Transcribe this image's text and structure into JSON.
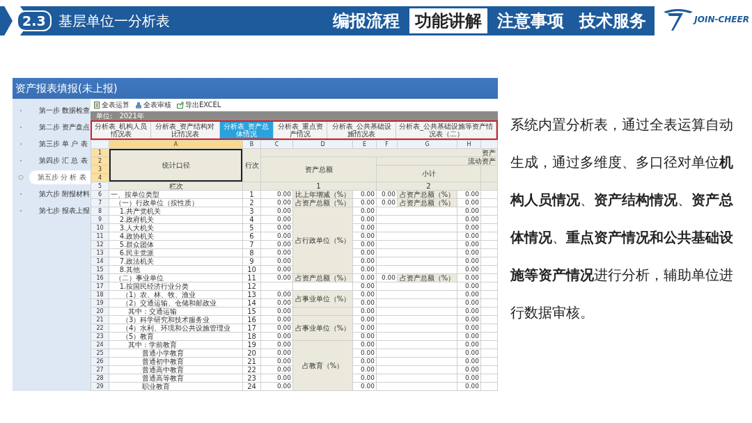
{
  "header": {
    "section_number": "2.3",
    "title": "基层单位一分析表",
    "logo_text": "JOIN-CHEER",
    "nav": [
      {
        "label": "编报流程",
        "selected": false
      },
      {
        "label": "功能讲解",
        "selected": true
      },
      {
        "label": "注意事项",
        "selected": false
      },
      {
        "label": "技术服务",
        "selected": false
      }
    ]
  },
  "app": {
    "title": "资产报表填报(未上报)",
    "steps": [
      {
        "label": "第一步 数据检查",
        "selected": false
      },
      {
        "label": "第二步 资产盘点",
        "selected": false
      },
      {
        "label": "第三步 单 户 表",
        "selected": false
      },
      {
        "label": "第四步 汇 总 表",
        "selected": false
      },
      {
        "label": "第五步 分 析 表",
        "selected": true
      },
      {
        "label": "第六步 附报材料",
        "selected": false
      },
      {
        "label": "第七步 报表上报",
        "selected": false
      }
    ],
    "toolbar": [
      {
        "label": "全表运算",
        "kind": "calc"
      },
      {
        "label": "全表审核",
        "kind": "audit"
      },
      {
        "label": "导出EXCEL",
        "kind": "export"
      }
    ],
    "info": {
      "unit_label": "单位:",
      "year": "2021年"
    },
    "sheet_tabs": [
      {
        "label": "分析表_机构人员情况表",
        "selected": false
      },
      {
        "label": "分析表_资产结构对比情况表",
        "selected": false
      },
      {
        "label": "分析表_资产总体情况",
        "selected": true
      },
      {
        "label": "分析表_重点资产情况",
        "selected": false
      },
      {
        "label": "分析表_公共基础设施情况表",
        "selected": false
      },
      {
        "label": "分析表_公共基础设施等资产情况表（二）",
        "selected": false
      }
    ],
    "grid": {
      "columns": [
        "A",
        "B",
        "C",
        "D",
        "E",
        "F",
        "G",
        "H"
      ],
      "header_rows": [
        "1",
        "2",
        "3",
        "4",
        "5"
      ],
      "scope_heading": "统计口径",
      "line_heading": "行次",
      "asset_heading": "资产",
      "total_heading": "资产总额",
      "current_heading": "流动资产",
      "subtotal_heading": "小计",
      "col_heading": "栏次",
      "col_1": "1",
      "col_2": "2",
      "rows": [
        {
          "num": "6",
          "label": "一、按单位类型",
          "line": "1",
          "ratio": {
            "text": "比上年增减（%）",
            "shaded": true
          },
          "c": "0.00",
          "e": "0.00",
          "f": "0.00",
          "g": "占资产总额（%）",
          "h": "0.00"
        },
        {
          "num": "7",
          "label": "  （一）行政单位（按性质）",
          "line": "2",
          "ratio": {
            "text": "占资产总额（%）",
            "shaded": true
          },
          "c": "0.00",
          "e": "0.00",
          "f": "0.00",
          "g": "占资产总额（%）",
          "h": "0.00"
        },
        {
          "num": "8",
          "label": "    1.共产党机关",
          "line": "3",
          "ratio": {
            "text": "占行政单位（%）",
            "shaded": true
          },
          "c": "0.00",
          "e": "0.00",
          "h": "0.00"
        },
        {
          "num": "9",
          "label": "    2.政府机关",
          "line": "4",
          "c": "0.00",
          "e": "0.00",
          "h": "0.00"
        },
        {
          "num": "10",
          "label": "    3.人大机关",
          "line": "5",
          "c": "0.00",
          "e": "0.00",
          "h": "0.00"
        },
        {
          "num": "11",
          "label": "    4.政协机关",
          "line": "6",
          "c": "0.00",
          "e": "0.00",
          "h": "0.00"
        },
        {
          "num": "12",
          "label": "    5.群众团体",
          "line": "7",
          "c": "0.00",
          "e": "0.00",
          "h": "0.00"
        },
        {
          "num": "13",
          "label": "    6.民主党派",
          "line": "8",
          "c": "0.00",
          "e": "0.00",
          "h": "0.00"
        },
        {
          "num": "14",
          "label": "    7.政法机关",
          "line": "9",
          "c": "0.00",
          "e": "0.00",
          "h": "0.00"
        },
        {
          "num": "15",
          "label": "    8.其他",
          "line": "10",
          "c": "0.00",
          "e": "0.00",
          "h": "0.00"
        },
        {
          "num": "16",
          "label": "  （二）事业单位",
          "line": "11",
          "ratio": {
            "text": "占资产总额（%）",
            "shaded": true
          },
          "c": "0.00",
          "e": "0.00",
          "f": "0.00",
          "g": "占资产总额（%）",
          "h": "0.00"
        },
        {
          "num": "17",
          "label": "    1.按国民经济行业分类",
          "line": "12",
          "ratio": {
            "shaded": false
          },
          "e": "0.00",
          "h": "0.00"
        },
        {
          "num": "18",
          "label": "     （1）农、林、牧、渔业",
          "line": "13",
          "ratio": {
            "text": "占事业单位（%）",
            "shaded": true
          },
          "c": "0.00",
          "e": "0.00",
          "h": "0.00"
        },
        {
          "num": "19",
          "label": "     （2）交通运输、仓储和邮政业",
          "line": "14",
          "c": "0.00",
          "e": "0.00",
          "h": "0.00"
        },
        {
          "num": "20",
          "label": "        其中：交通运输",
          "line": "15",
          "ratio": {
            "shaded": true
          },
          "c": "0.00",
          "e": "0.00",
          "h": "0.00"
        },
        {
          "num": "21",
          "label": "     （3）科学研究和技术服务业",
          "line": "16",
          "ratio": {
            "text": "占事业单位（%）",
            "shaded": true
          },
          "c": "0.00",
          "e": "0.00",
          "h": "0.00"
        },
        {
          "num": "22",
          "label": "     （4）水利、环境和公共设施管理业",
          "line": "17",
          "c": "0.00",
          "e": "0.00",
          "h": "0.00"
        },
        {
          "num": "23",
          "label": "     （5）教育",
          "line": "18",
          "c": "0.00",
          "e": "0.00",
          "h": "0.00"
        },
        {
          "num": "24",
          "label": "        其中：学前教育",
          "line": "19",
          "ratio": {
            "text": "占教育（%）",
            "shaded": true
          },
          "c": "0.00",
          "e": "0.00",
          "h": "0.00"
        },
        {
          "num": "25",
          "label": "              普通小学教育",
          "line": "20",
          "c": "0.00",
          "e": "0.00",
          "h": "0.00"
        },
        {
          "num": "26",
          "label": "              普通初中教育",
          "line": "21",
          "c": "0.00",
          "e": "0.00",
          "h": "0.00"
        },
        {
          "num": "27",
          "label": "              普通高中教育",
          "line": "22",
          "c": "0.00",
          "e": "0.00",
          "h": "0.00"
        },
        {
          "num": "28",
          "label": "              普通高等教育",
          "line": "23",
          "c": "0.00",
          "e": "0.00",
          "h": "0.00"
        },
        {
          "num": "29",
          "label": "              职业教育",
          "line": "24",
          "c": "0.00",
          "e": "0.00",
          "h": "0.00"
        }
      ]
    }
  },
  "description": "系统内置分析表，通过全表运算自动生成，通过多维度、多口径对单位**机构人员情况**、**资产结构情况**、**资产总体情况**、**重点资产情况和公共基础设施等资产情况**进行分析，辅助单位进行数据审核。"
}
